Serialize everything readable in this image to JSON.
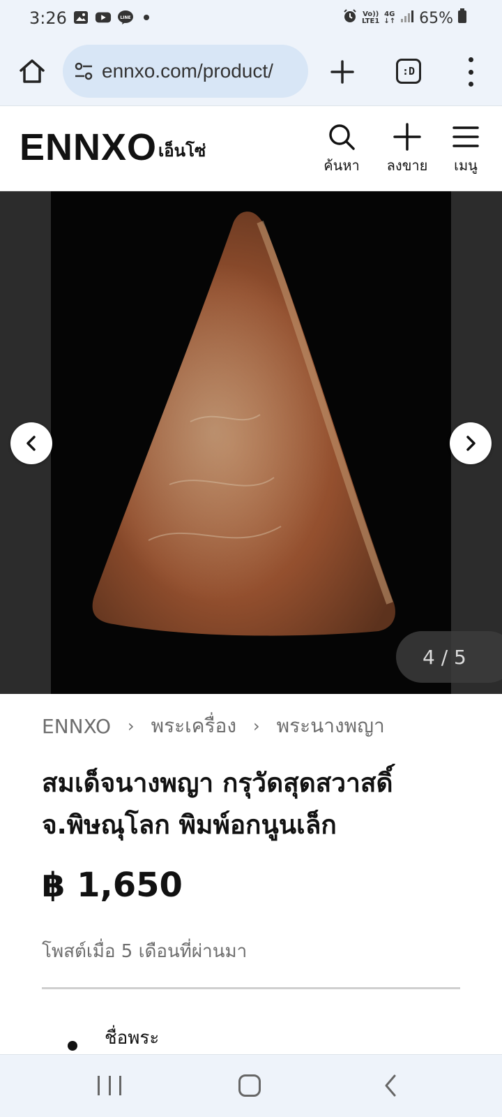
{
  "status_bar": {
    "time": "3:26",
    "left_icons": [
      "gallery-icon",
      "youtube-icon",
      "line-icon"
    ],
    "right_icons": [
      "alarm-icon",
      "volte-icon",
      "4g-icon",
      "signal-icon"
    ],
    "volte_top": "Vo))",
    "volte_bottom": "LTE1",
    "net_type": "4G",
    "battery": "65%"
  },
  "browser": {
    "url": "ennxo.com/product/",
    "tabs_label": ":D"
  },
  "header": {
    "logo": "ENNXO",
    "logo_thai": "เอ็นโซ่",
    "search_label": "ค้นหา",
    "sell_label": "ลงขาย",
    "menu_label": "เมนู"
  },
  "gallery": {
    "counter": "4 / 5",
    "current": 4,
    "total": 5
  },
  "breadcrumb": [
    "ENNXO",
    "พระเครื่อง",
    "พระนางพญา"
  ],
  "product": {
    "title_line1": "สมเด็จนางพญา กรุวัดสุดสวาสดิ์",
    "title_line2": "จ.พิษณุโลก พิมพ์อกนูนเล็ก",
    "price": "฿ 1,650",
    "posted": "โพสต์เมื่อ 5 เดือนที่ผ่านมา",
    "spec_label": "ชื่อพระ"
  },
  "colors": {
    "chrome": "#eef3fa",
    "url_pill": "#d8e6f6",
    "text_muted": "#6d6d6d",
    "carousel_bg": "#2c2c2c"
  }
}
